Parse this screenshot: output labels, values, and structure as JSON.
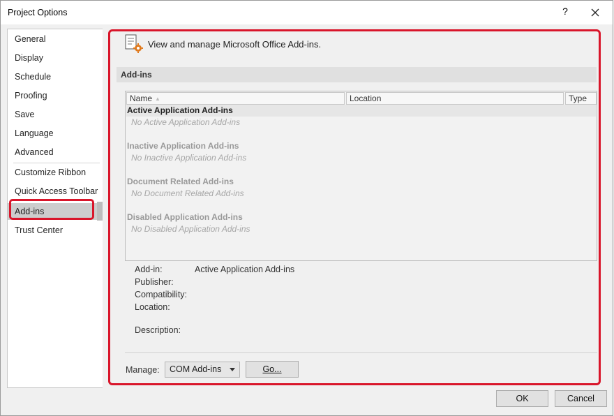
{
  "window": {
    "title": "Project Options",
    "help_label": "?",
    "close_icon": "close-icon"
  },
  "nav": {
    "items": [
      {
        "label": "General"
      },
      {
        "label": "Display"
      },
      {
        "label": "Schedule"
      },
      {
        "label": "Proofing"
      },
      {
        "label": "Save"
      },
      {
        "label": "Language"
      },
      {
        "label": "Advanced"
      },
      {
        "label": "Customize Ribbon"
      },
      {
        "label": "Quick Access Toolbar"
      },
      {
        "label": "Add-ins"
      },
      {
        "label": "Trust Center"
      }
    ],
    "selected": "Add-ins"
  },
  "header": {
    "icon": "addins-settings-icon",
    "text": "View and manage Microsoft Office Add-ins."
  },
  "section": {
    "title": "Add-ins"
  },
  "table": {
    "columns": [
      "Name",
      "Location",
      "Type"
    ],
    "groups": [
      {
        "title": "Active Application Add-ins",
        "empty": "No Active Application Add-ins"
      },
      {
        "title": "Inactive Application Add-ins",
        "empty": "No Inactive Application Add-ins"
      },
      {
        "title": "Document Related Add-ins",
        "empty": "No Document Related Add-ins"
      },
      {
        "title": "Disabled Application Add-ins",
        "empty": "No Disabled Application Add-ins"
      }
    ]
  },
  "details": {
    "addin_label": "Add-in:",
    "addin_value": "Active Application Add-ins",
    "publisher_label": "Publisher:",
    "compatibility_label": "Compatibility:",
    "location_label": "Location:",
    "description_label": "Description:"
  },
  "manage": {
    "label": "Manage:",
    "selected": "COM Add-ins",
    "go_label": "Go..."
  },
  "footer": {
    "ok_label": "OK",
    "cancel_label": "Cancel"
  },
  "colors": {
    "highlight": "#d9152a",
    "selected_nav": "#cdcdcd"
  }
}
